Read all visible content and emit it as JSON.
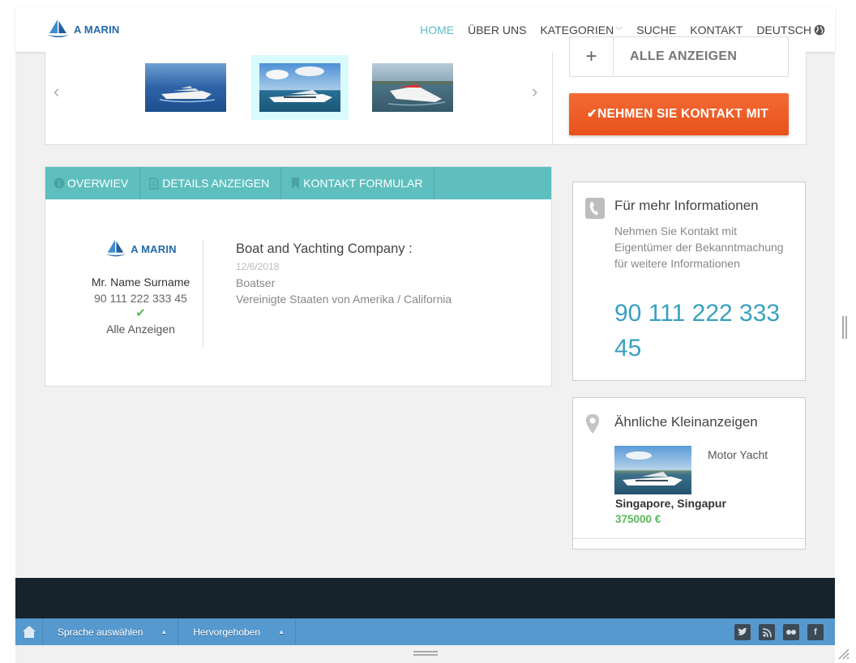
{
  "brand": {
    "logo_text": "A MARIN"
  },
  "nav": {
    "items": [
      {
        "label": "HOME",
        "active": true
      },
      {
        "label": "ÜBER UNS"
      },
      {
        "label": "KATEGORIEN",
        "has_dropdown": true
      },
      {
        "label": "SUCHE"
      },
      {
        "label": "KONTAKT"
      },
      {
        "label": "DEUTSCH",
        "icon": "globe-icon"
      }
    ]
  },
  "gallery": {
    "selected_index": 1,
    "thumbs": [
      "yacht-photo-1",
      "yacht-photo-2",
      "yacht-photo-3"
    ]
  },
  "actions": {
    "all_ads_label": "ALLE ANZEIGEN",
    "contact_label": "NEHMEN SIE KONTAKT MIT"
  },
  "tabs": [
    {
      "label": "OVERWIEV",
      "icon": "info-icon"
    },
    {
      "label": "DETAILS ANZEIGEN",
      "icon": "document-icon"
    },
    {
      "label": "KONTAKT FORMULAR",
      "icon": "bookmark-icon"
    }
  ],
  "seller": {
    "logo_text": "A MARIN",
    "name": "Mr. Name Surname",
    "phone": "90 111 222 333 45",
    "all_ads_link": "Alle Anzeigen"
  },
  "company": {
    "title": "Boat and Yachting Company :",
    "date": "12/6/2018",
    "type": "Boatser",
    "location": "Vereinigte Staaten von Amerika / California"
  },
  "info_box": {
    "title": "Für mehr Informationen",
    "text": "Nehmen Sie Kontakt mit Eigentümer der Bekanntmachung für weitere Informationen",
    "phone": "90 111 222 333 45"
  },
  "similar": {
    "title": "Ähnliche Kleinanzeigen",
    "item": {
      "type": "Motor Yacht",
      "location": "Singapore, Singapur",
      "price": "375000 €"
    }
  },
  "bottom_bar": {
    "language_label": "Sprache auswählen",
    "featured_label": "Hervorgehoben",
    "social": [
      "twitter-icon",
      "rss-icon",
      "flickr-icon",
      "facebook-icon"
    ]
  },
  "colors": {
    "accent": "#5bbcc4",
    "tab_bar": "#5fbfbf",
    "contact_button": "#ec5a22",
    "phone_text": "#3aa0c0",
    "price": "#5cb85c",
    "footer_dark": "#17232c",
    "footer_bar": "#5599cf"
  }
}
